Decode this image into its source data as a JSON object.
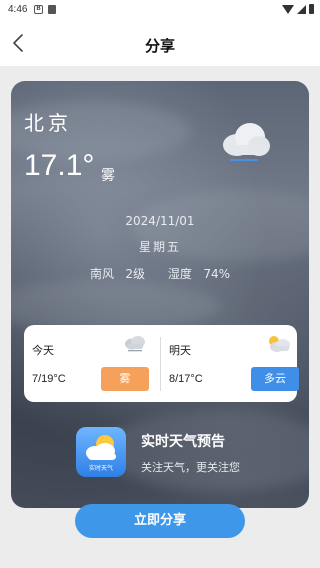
{
  "status_bar": {
    "time": "4:46",
    "notification_icon_letter": "B"
  },
  "nav": {
    "title": "分享"
  },
  "card": {
    "city": "北京",
    "temperature": "17.1°",
    "weather": "雾",
    "date": "2024/11/01",
    "weekday": "星期五",
    "wind_humidity": "南风   2级      湿度   74%"
  },
  "forecast": {
    "today": {
      "label": "今天",
      "temp_range": "7/19°C",
      "condition": "雾",
      "color": "#f5a15b",
      "icon": "fog-cloud-icon"
    },
    "tomorrow": {
      "label": "明天",
      "temp_range": "8/17°C",
      "condition": "多云",
      "color": "#3f8ee8",
      "icon": "partly-cloudy-icon"
    }
  },
  "app": {
    "logo_text": "实时天气",
    "name": "实时天气预告",
    "slogan": "关注天气，更关注您"
  },
  "share_button_label": "立即分享",
  "colors": {
    "accent": "#3f97ea"
  }
}
